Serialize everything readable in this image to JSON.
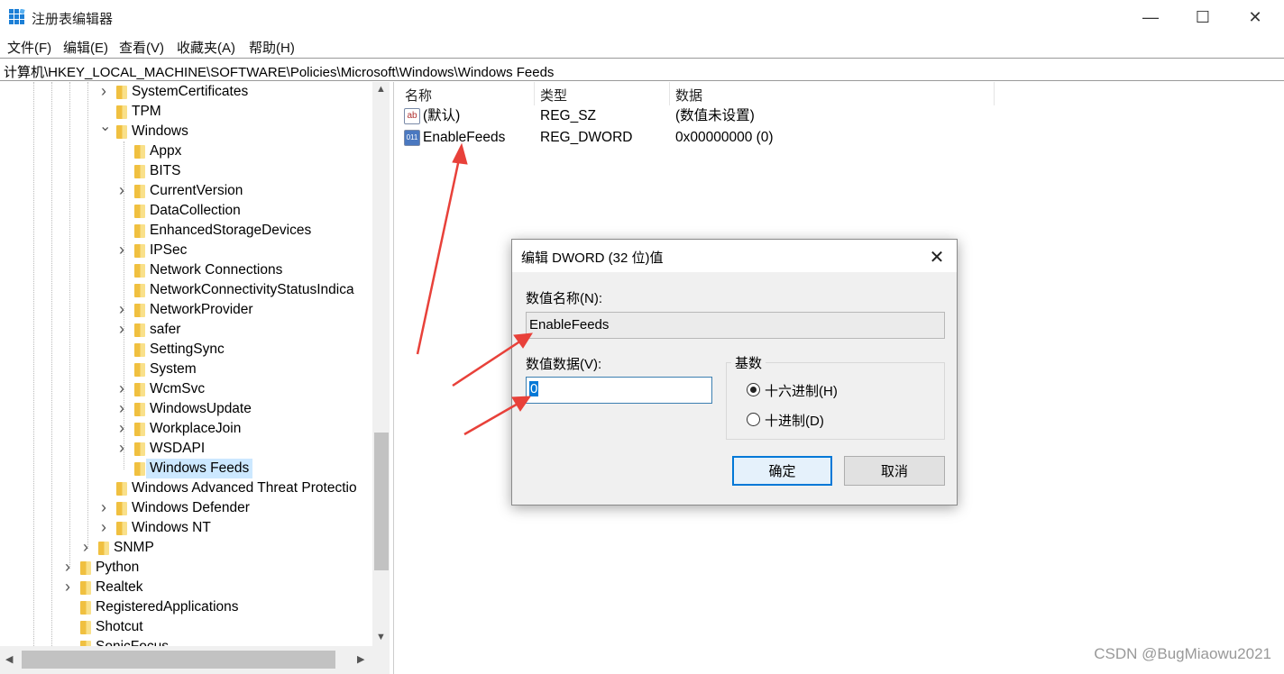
{
  "window": {
    "title": "注册表编辑器",
    "minimize_glyph": "—",
    "maximize_glyph": "☐",
    "close_glyph": "✕"
  },
  "menu": [
    "文件(F)",
    "编辑(E)",
    "查看(V)",
    "收藏夹(A)",
    "帮助(H)"
  ],
  "address": "计算机\\HKEY_LOCAL_MACHINE\\SOFTWARE\\Policies\\Microsoft\\Windows\\Windows Feeds",
  "tree": {
    "nodes": [
      {
        "label": "SystemCertificates",
        "level": 2,
        "expander": "collapsed"
      },
      {
        "label": "TPM",
        "level": 2,
        "expander": "none"
      },
      {
        "label": "Windows",
        "level": 2,
        "expander": "expanded"
      },
      {
        "label": "Appx",
        "level": 3,
        "expander": "none"
      },
      {
        "label": "BITS",
        "level": 3,
        "expander": "none"
      },
      {
        "label": "CurrentVersion",
        "level": 3,
        "expander": "collapsed"
      },
      {
        "label": "DataCollection",
        "level": 3,
        "expander": "none"
      },
      {
        "label": "EnhancedStorageDevices",
        "level": 3,
        "expander": "none"
      },
      {
        "label": "IPSec",
        "level": 3,
        "expander": "collapsed"
      },
      {
        "label": "Network Connections",
        "level": 3,
        "expander": "none"
      },
      {
        "label": "NetworkConnectivityStatusIndica",
        "level": 3,
        "expander": "none"
      },
      {
        "label": "NetworkProvider",
        "level": 3,
        "expander": "collapsed"
      },
      {
        "label": "safer",
        "level": 3,
        "expander": "collapsed"
      },
      {
        "label": "SettingSync",
        "level": 3,
        "expander": "none"
      },
      {
        "label": "System",
        "level": 3,
        "expander": "none"
      },
      {
        "label": "WcmSvc",
        "level": 3,
        "expander": "collapsed"
      },
      {
        "label": "WindowsUpdate",
        "level": 3,
        "expander": "collapsed"
      },
      {
        "label": "WorkplaceJoin",
        "level": 3,
        "expander": "collapsed"
      },
      {
        "label": "WSDAPI",
        "level": 3,
        "expander": "collapsed"
      },
      {
        "label": "Windows Feeds",
        "level": 3,
        "expander": "none",
        "selected": true
      },
      {
        "label": "Windows Advanced Threat Protectio",
        "level": 2,
        "expander": "none"
      },
      {
        "label": "Windows Defender",
        "level": 2,
        "expander": "collapsed"
      },
      {
        "label": "Windows NT",
        "level": 2,
        "expander": "collapsed"
      },
      {
        "label": "SNMP",
        "level": 1,
        "expander": "collapsed"
      },
      {
        "label": "Python",
        "level": 0,
        "expander": "collapsed"
      },
      {
        "label": "Realtek",
        "level": 0,
        "expander": "collapsed"
      },
      {
        "label": "RegisteredApplications",
        "level": 0,
        "expander": "none"
      },
      {
        "label": "Shotcut",
        "level": 0,
        "expander": "none"
      },
      {
        "label": "SonicFocus",
        "level": 0,
        "expander": "none"
      }
    ]
  },
  "list": {
    "headers": {
      "name": "名称",
      "type": "类型",
      "data": "数据"
    },
    "rows": [
      {
        "icon": "ab",
        "name": "(默认)",
        "type": "REG_SZ",
        "data": "(数值未设置)"
      },
      {
        "icon": "011",
        "name": "EnableFeeds",
        "type": "REG_DWORD",
        "data": "0x00000000 (0)"
      }
    ]
  },
  "dialog": {
    "title": "编辑 DWORD (32 位)值",
    "name_label": "数值名称(N):",
    "name_value": "EnableFeeds",
    "data_label": "数值数据(V):",
    "data_value": "0",
    "base_label": "基数",
    "radio_hex": "十六进制(H)",
    "radio_dec": "十进制(D)",
    "selected_base": "hex",
    "ok": "确定",
    "cancel": "取消"
  },
  "watermark": "CSDN @BugMiaowu2021",
  "colors": {
    "annotation_arrow": "#e8413a",
    "selection": "#cce8ff",
    "accent": "#0078d7"
  }
}
